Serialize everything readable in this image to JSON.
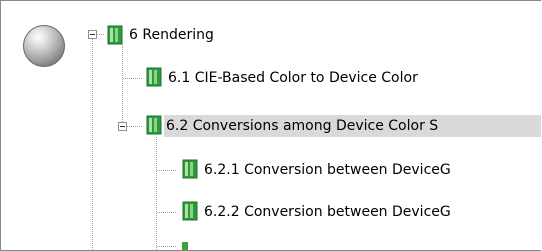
{
  "tree": {
    "nodes": [
      {
        "label": "6 Rendering"
      },
      {
        "label": "6.1 CIE-Based Color to Device Color"
      },
      {
        "label": "6.2 Conversions among Device Color S"
      },
      {
        "label": "6.2.1 Conversion between DeviceG"
      },
      {
        "label": "6.2.2 Conversion between DeviceG"
      }
    ]
  }
}
